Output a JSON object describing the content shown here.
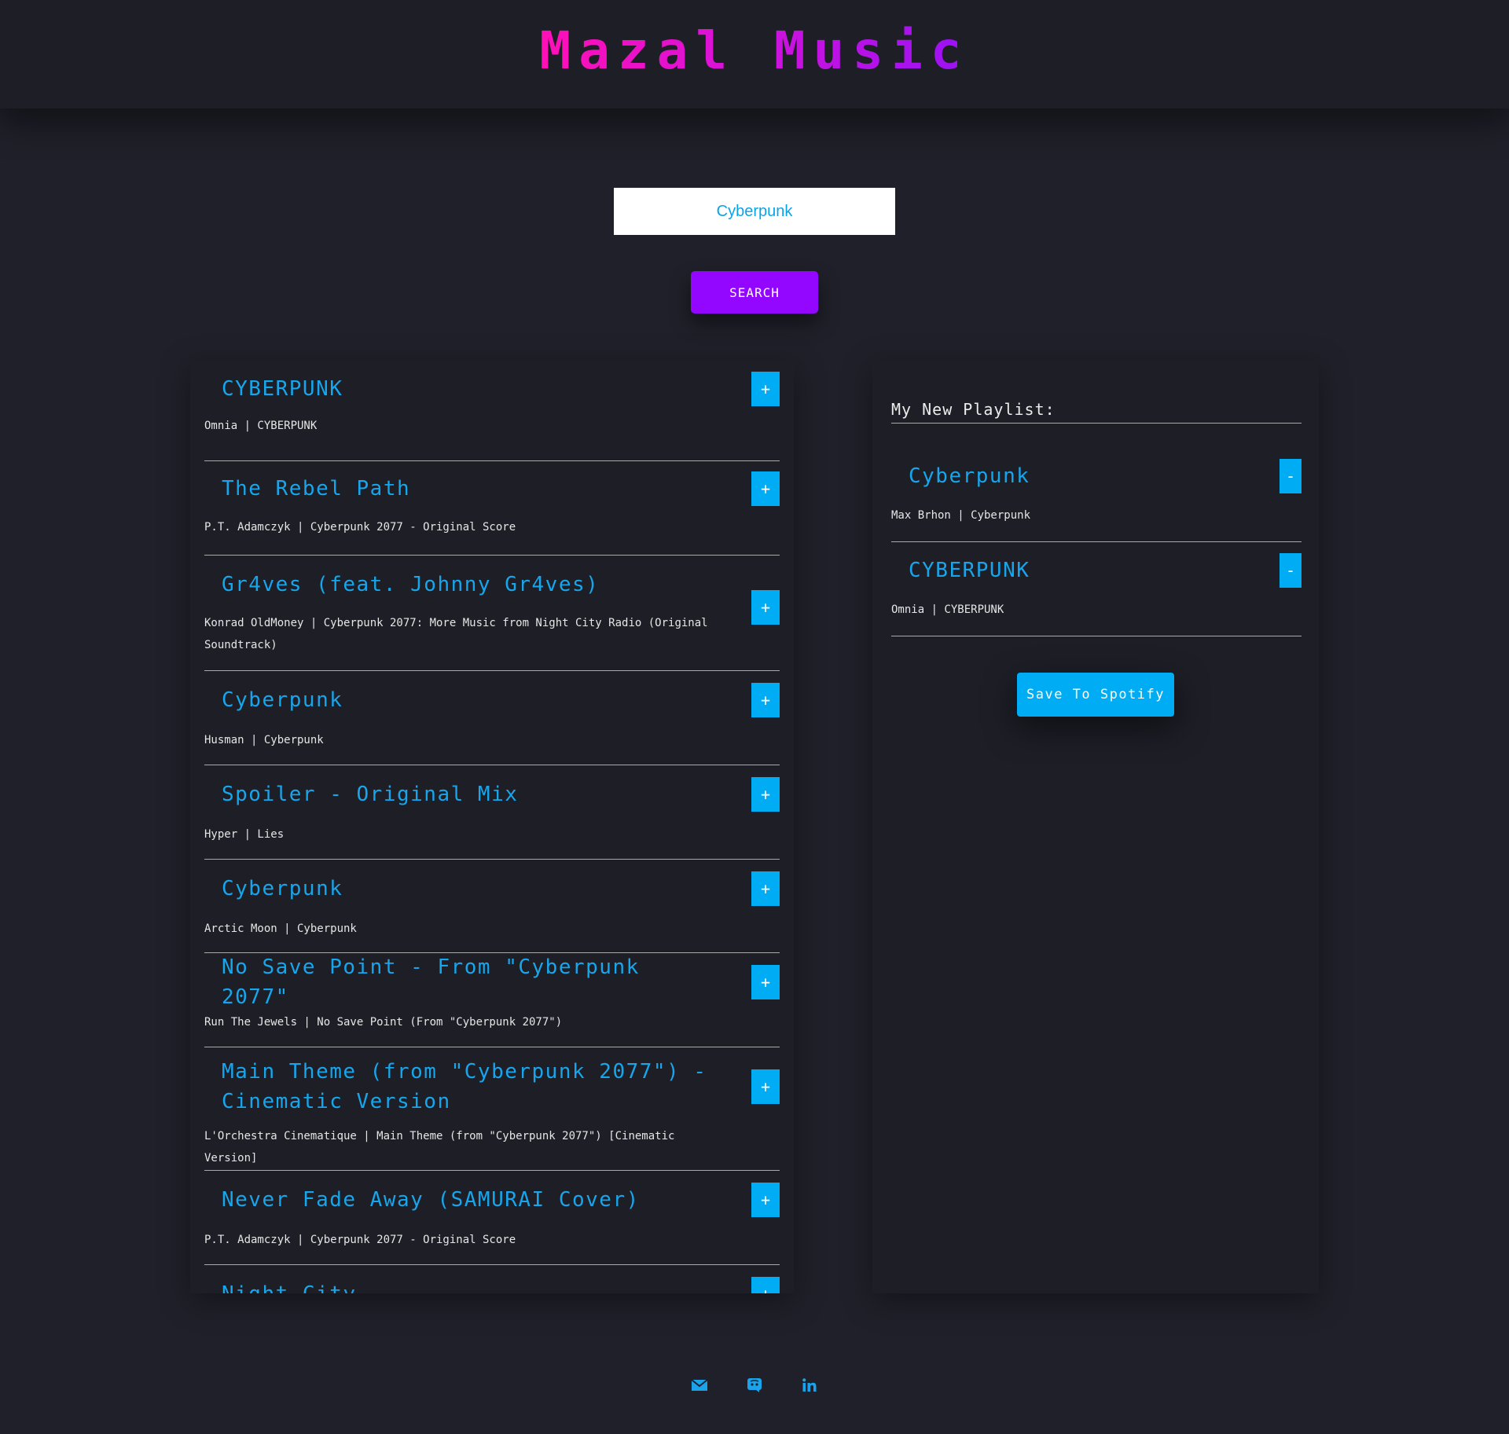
{
  "header": {
    "title": "Mazal Music"
  },
  "search": {
    "value": "Cyberpunk",
    "button_label": "SEARCH"
  },
  "results": [
    {
      "name": "CYBERPUNK",
      "info": "Omnia | CYBERPUNK",
      "action": "+"
    },
    {
      "name": "The Rebel Path",
      "info": "P.T. Adamczyk | Cyberpunk 2077 - Original Score",
      "action": "+"
    },
    {
      "name": "Gr4ves (feat. Johnny Gr4ves)",
      "info": "Konrad OldMoney | Cyberpunk 2077: More Music from Night City Radio (Original Soundtrack)",
      "action": "+"
    },
    {
      "name": "Cyberpunk",
      "info": "Husman | Cyberpunk",
      "action": "+"
    },
    {
      "name": "Spoiler - Original Mix",
      "info": "Hyper | Lies",
      "action": "+"
    },
    {
      "name": "Cyberpunk",
      "info": "Arctic Moon | Cyberpunk",
      "action": "+"
    },
    {
      "name": "No Save Point - From \"Cyberpunk 2077\"",
      "info": "Run The Jewels | No Save Point (From \"Cyberpunk 2077\")",
      "action": "+"
    },
    {
      "name": "Main Theme (from \"Cyberpunk 2077\") - Cinematic Version",
      "info": "L'Orchestra Cinematique | Main Theme (from \"Cyberpunk 2077\") [Cinematic Version]",
      "action": "+"
    },
    {
      "name": "Never Fade Away (SAMURAI Cover)",
      "info": "P.T. Adamczyk | Cyberpunk 2077 - Original Score",
      "action": "+"
    },
    {
      "name": "Night City",
      "info": "",
      "action": "+"
    }
  ],
  "playlist": {
    "title": "My New Playlist:",
    "tracks": [
      {
        "name": "Cyberpunk",
        "info": "Max Brhon | Cyberpunk",
        "action": "-"
      },
      {
        "name": "CYBERPUNK",
        "info": "Omnia | CYBERPUNK",
        "action": "-"
      }
    ],
    "save_label": "Save To Spotify"
  },
  "footer": {
    "icons": [
      "envelope-icon",
      "discord-icon",
      "linkedin-icon"
    ],
    "icon_color": "#1aa3ea"
  },
  "colors": {
    "background": "#1f2029",
    "accent_blue": "#00adf5",
    "search_purple": "#9306ff",
    "title_gradient": [
      "#ff10b6",
      "#9a12f5"
    ]
  }
}
